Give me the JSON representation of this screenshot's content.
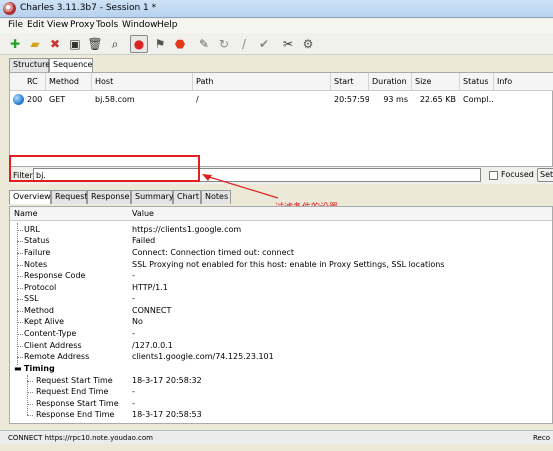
{
  "window": {
    "title": "Charles 3.11.3b7 - Session 1 *"
  },
  "menu": [
    "File",
    "Edit",
    "View",
    "Proxy",
    "Tools",
    "Window",
    "Help"
  ],
  "toolbar": {
    "icons": [
      "new-session",
      "open",
      "close-session",
      "save",
      "trash",
      "find",
      "record",
      "throttle",
      "stop",
      "edit",
      "repeat",
      "compose",
      "validate",
      "tools",
      "settings"
    ]
  },
  "top_tabs": [
    "Structure",
    "Sequence"
  ],
  "table": {
    "columns": [
      "RC",
      "Method",
      "Host",
      "Path",
      "Start",
      "Duration",
      "Size",
      "Status",
      "Info"
    ],
    "rows": [
      {
        "rc": "200",
        "method": "GET",
        "host": "bj.58.com",
        "path": "/",
        "start": "20:57:59",
        "duration": "93 ms",
        "size": "22.65 KB",
        "status": "Compl...",
        "info": ""
      }
    ]
  },
  "filter": {
    "label": "Filter:",
    "value": "bj.",
    "focused_label": "Focused",
    "settings_label": "Settings"
  },
  "annotation": "过滤条件的设置",
  "detail_tabs": [
    "Overview",
    "Request",
    "Response",
    "Summary",
    "Chart",
    "Notes"
  ],
  "detail": {
    "name_header": "Name",
    "value_header": "Value",
    "rows": [
      {
        "name": "URL",
        "value": "https://clients1.google.com"
      },
      {
        "name": "Status",
        "value": "Failed"
      },
      {
        "name": "Failure",
        "value": "Connect: Connection timed out: connect"
      },
      {
        "name": "Notes",
        "value": "SSL Proxying not enabled for this host: enable in Proxy Settings, SSL locations"
      },
      {
        "name": "Response Code",
        "value": "-"
      },
      {
        "name": "Protocol",
        "value": "HTTP/1.1"
      },
      {
        "name": "SSL",
        "value": "-"
      },
      {
        "name": "Method",
        "value": "CONNECT"
      },
      {
        "name": "Kept Alive",
        "value": "No"
      },
      {
        "name": "Content-Type",
        "value": "-"
      },
      {
        "name": "Client Address",
        "value": "/127.0.0.1"
      },
      {
        "name": "Remote Address",
        "value": "clients1.google.com/74.125.23.101"
      }
    ],
    "timing_label": "Timing",
    "timing_rows": [
      {
        "name": "Request Start Time",
        "value": "18-3-17 20:58:32"
      },
      {
        "name": "Request End Time",
        "value": "-"
      },
      {
        "name": "Response Start Time",
        "value": "-"
      },
      {
        "name": "Response End Time",
        "value": "18-3-17 20:58:53"
      }
    ]
  },
  "statusbar": {
    "text": "CONNECT https://rpc10.note.youdao.com",
    "right": "Reco"
  }
}
